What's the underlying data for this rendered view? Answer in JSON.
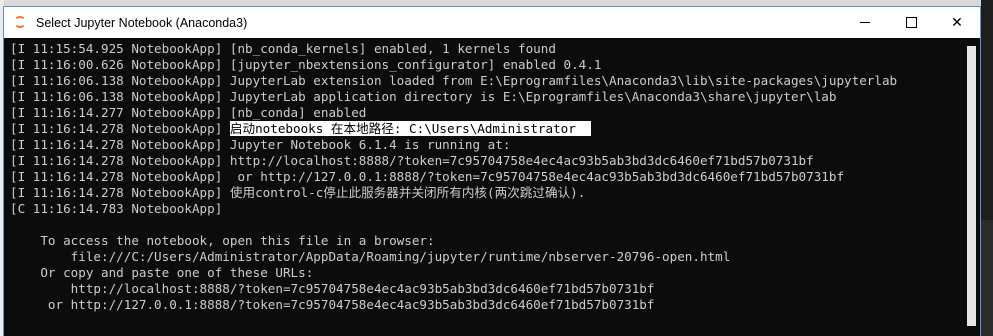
{
  "window": {
    "title": "Select Jupyter Notebook (Anaconda3)",
    "controls": {
      "minimize": "minimize",
      "maximize": "maximize",
      "close": "✕"
    }
  },
  "console": {
    "lines": [
      {
        "text": "[I 11:15:54.925 NotebookApp] [nb_conda_kernels] enabled, 1 kernels found"
      },
      {
        "text": "[I 11:16:00.626 NotebookApp] [jupyter_nbextensions_configurator] enabled 0.4.1"
      },
      {
        "text": "[I 11:16:06.138 NotebookApp] JupyterLab extension loaded from E:\\Eprogramfiles\\Anaconda3\\lib\\site-packages\\jupyterlab"
      },
      {
        "text": "[I 11:16:06.138 NotebookApp] JupyterLab application directory is E:\\Eprogramfiles\\Anaconda3\\share\\jupyter\\lab"
      },
      {
        "text": "[I 11:16:14.277 NotebookApp] [nb_conda] enabled"
      },
      {
        "prefix": "[I 11:16:14.278 NotebookApp] ",
        "highlight": "启动notebooks 在本地路径: C:\\Users\\Administrator  "
      },
      {
        "text": "[I 11:16:14.278 NotebookApp] Jupyter Notebook 6.1.4 is running at:"
      },
      {
        "text": "[I 11:16:14.278 NotebookApp] http://localhost:8888/?token=7c95704758e4ec4ac93b5ab3bd3dc6460ef71bd57b0731bf"
      },
      {
        "text": "[I 11:16:14.278 NotebookApp]  or http://127.0.0.1:8888/?token=7c95704758e4ec4ac93b5ab3bd3dc6460ef71bd57b0731bf"
      },
      {
        "text": "[I 11:16:14.278 NotebookApp] 使用control-c停止此服务器并关闭所有内核(两次跳过确认)."
      },
      {
        "text": "[C 11:16:14.783 NotebookApp]"
      },
      {
        "text": ""
      },
      {
        "text": "    To access the notebook, open this file in a browser:"
      },
      {
        "text": "        file:///C:/Users/Administrator/AppData/Roaming/jupyter/runtime/nbserver-20796-open.html"
      },
      {
        "text": "    Or copy and paste one of these URLs:"
      },
      {
        "text": "        http://localhost:8888/?token=7c95704758e4ec4ac93b5ab3bd3dc6460ef71bd57b0731bf"
      },
      {
        "text": "     or http://127.0.0.1:8888/?token=7c95704758e4ec4ac93b5ab3bd3dc6460ef71bd57b0731bf"
      }
    ]
  },
  "colors": {
    "console_bg": "#0c0c0c",
    "console_text": "#cccccc",
    "titlebar_bg": "#ffffff",
    "jupyter_orange": "#f37726"
  },
  "icons": {
    "app": "jupyter-icon"
  }
}
